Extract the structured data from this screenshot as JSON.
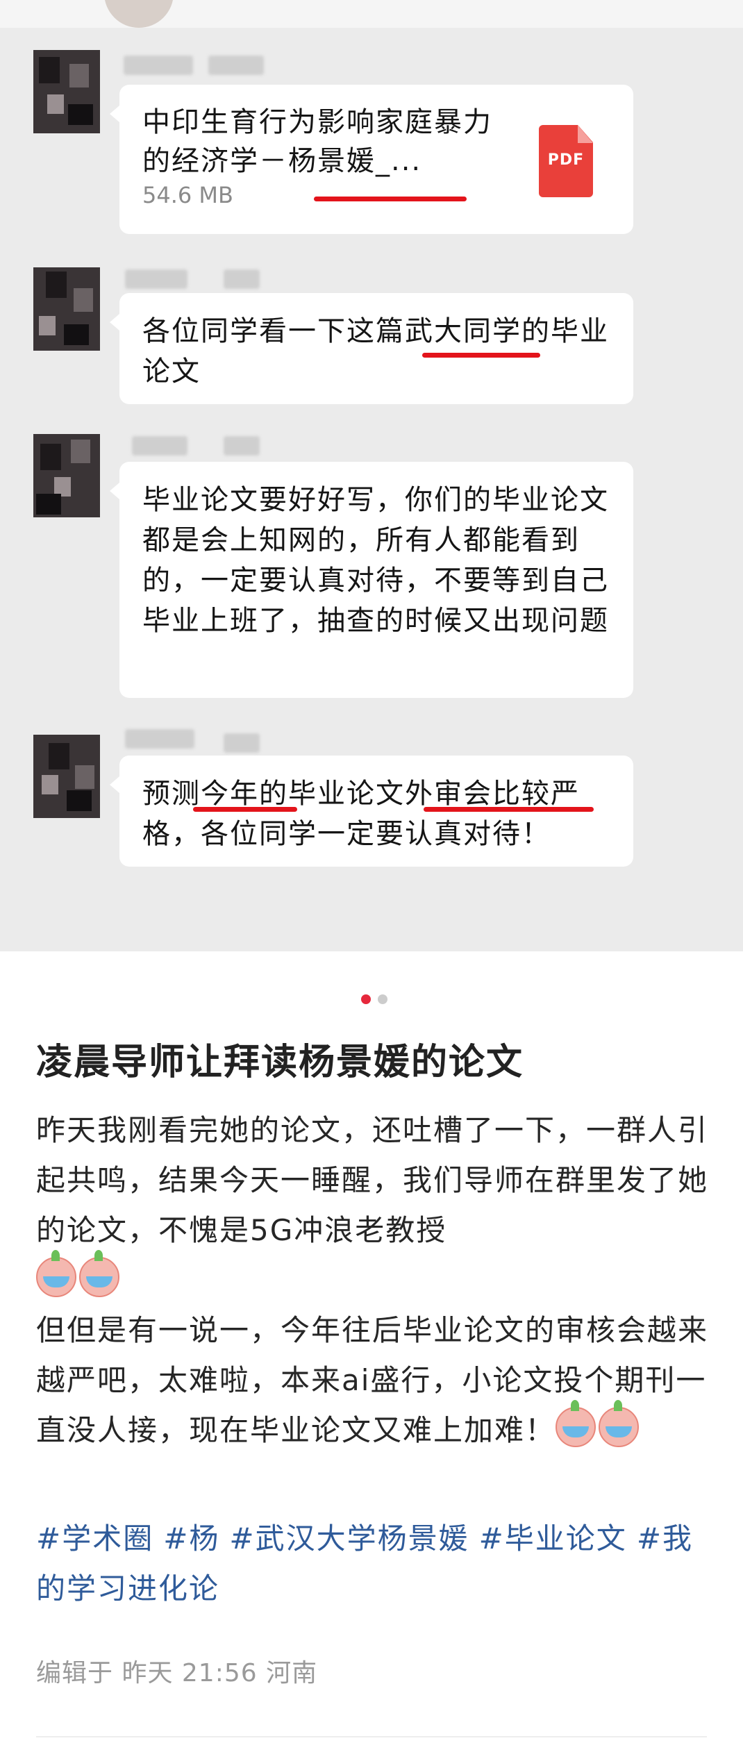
{
  "chat": {
    "messages": [
      {
        "type": "file",
        "file_name": "中印生育行为影响家庭暴力的经济学－杨景媛_...",
        "file_size": "54.6 MB",
        "file_icon": "pdf-icon",
        "icon_label": "PDF"
      },
      {
        "type": "text",
        "text": "各位同学看一下这篇武大同学的毕业论文"
      },
      {
        "type": "text",
        "text": "毕业论文要好好写，你们的毕业论文都是会上知网的，所有人都能看到的，一定要认真对待，不要等到自己毕业上班了，抽查的时候又出现问题"
      },
      {
        "type": "text",
        "text": "预测今年的毕业论文外审会比较严格，各位同学一定要认真对待！"
      }
    ],
    "highlight_color": "#e3141b"
  },
  "carousel": {
    "active_index": 1,
    "count": 2,
    "active_color": "#e6283c",
    "inactive_color": "#cccccc"
  },
  "post": {
    "title": "凌晨导师让拜读杨景媛的论文",
    "paragraph1": "昨天我刚看完她的论文，还吐槽了一下，一群人引起共鸣，结果今天一睡醒，我们导师在群里发了她的论文，不愧是5G冲浪老教授",
    "paragraph2": "但但是有一说一，今年往后毕业论文的审核会越来越严吧，太难啦，本来ai盛行，小论文投个期刊一直没人接，现在毕业论文又难上加难！",
    "emoji_icon": "crying-peach-emoji",
    "tags": [
      "#学术圈",
      "#杨",
      "#武汉大学杨景媛",
      "#毕业论文",
      "#我的学习进化论"
    ],
    "tag_color": "#2f5b9a",
    "meta": "编辑于 昨天 21:56 河南"
  }
}
